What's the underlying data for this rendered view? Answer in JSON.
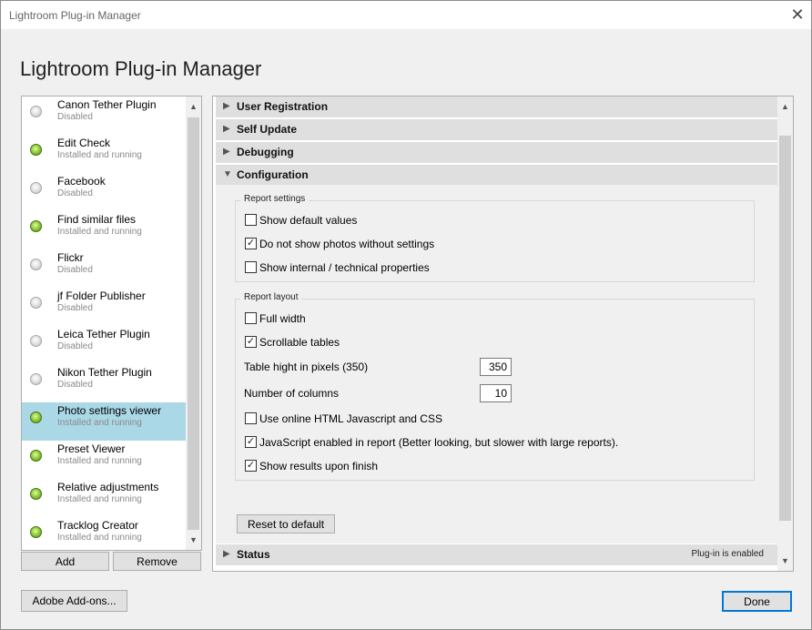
{
  "window": {
    "title": "Lightroom Plug-in Manager",
    "close_glyph": "✕"
  },
  "heading": "Lightroom Plug-in Manager",
  "plugins": [
    {
      "name": "Canon Tether Plugin",
      "status": "Disabled"
    },
    {
      "name": "Edit Check",
      "status": "Installed and running"
    },
    {
      "name": "Facebook",
      "status": "Disabled"
    },
    {
      "name": "Find similar files",
      "status": "Installed and running"
    },
    {
      "name": "Flickr",
      "status": "Disabled"
    },
    {
      "name": "jf Folder Publisher",
      "status": "Disabled"
    },
    {
      "name": "Leica Tether Plugin",
      "status": "Disabled"
    },
    {
      "name": "Nikon Tether Plugin",
      "status": "Disabled"
    },
    {
      "name": "Photo settings viewer",
      "status": "Installed and running"
    },
    {
      "name": "Preset Viewer",
      "status": "Installed and running"
    },
    {
      "name": "Relative adjustments",
      "status": "Installed and running"
    },
    {
      "name": "Tracklog Creator",
      "status": "Installed and running"
    }
  ],
  "list_buttons": {
    "add": "Add",
    "remove": "Remove"
  },
  "sections": {
    "user_registration": "User Registration",
    "self_update": "Self Update",
    "debugging": "Debugging",
    "configuration": "Configuration",
    "status": "Status",
    "status_text": "Plug-in is enabled"
  },
  "report_settings": {
    "label": "Report settings",
    "show_default_values": "Show default values",
    "do_not_show_photos": "Do not show photos without settings",
    "show_internal": "Show internal / technical properties"
  },
  "report_layout": {
    "label": "Report layout",
    "full_width": "Full width",
    "scrollable_tables": "Scrollable tables",
    "table_height_label": "Table hight in pixels (350)",
    "table_height_value": "350",
    "columns_label": "Number of columns",
    "columns_value": "10",
    "online_html": "Use online HTML Javascript and CSS",
    "javascript_enabled": "JavaScript enabled in report (Better looking, but slower with large reports).",
    "show_results": "Show results upon finish"
  },
  "reset_button": "Reset to default",
  "adobe_addons_button": "Adobe Add-ons...",
  "done_button": "Done",
  "glyphs": {
    "check": "✓",
    "expanded": "▼",
    "collapsed": "▶",
    "up": "▲",
    "down": "▼"
  }
}
